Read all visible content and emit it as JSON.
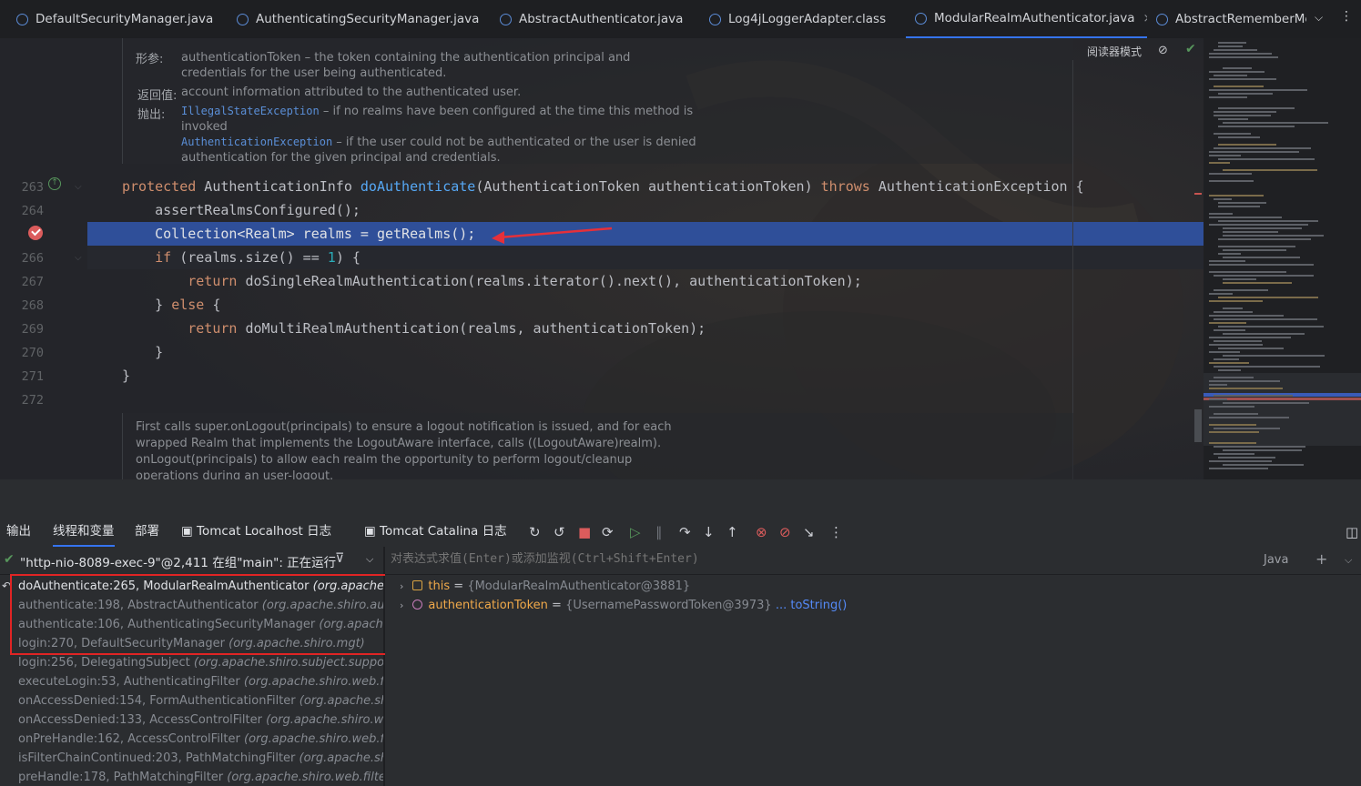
{
  "tabs": [
    {
      "label": "DefaultSecurityManager.java",
      "active": false
    },
    {
      "label": "AuthenticatingSecurityManager.java",
      "active": false
    },
    {
      "label": "AbstractAuthenticator.java",
      "active": false
    },
    {
      "label": "Log4jLoggerAdapter.class",
      "active": false
    },
    {
      "label": "ModularRealmAuthenticator.java",
      "active": true
    },
    {
      "label": "AbstractRememberMe",
      "active": false
    }
  ],
  "editor": {
    "reader_mode_label": "阅读器模式",
    "doc_top": {
      "params_label": "形参:",
      "params_text": "authenticationToken – the token containing the authentication principal and",
      "params_text2": "credentials for the user being authenticated.",
      "return_label": "返回值:",
      "return_text": "account information attributed to the authenticated user.",
      "throws_label": "抛出:",
      "throws_1_name": "IllegalStateException",
      "throws_1_text": " – if no realms have been configured at the time this method is",
      "throws_1_text2": "invoked",
      "throws_2_name": "AuthenticationException",
      "throws_2_text": " – if the user could not be authenticated or the user is denied",
      "throws_2_text2": "authentication for the given principal and credentials."
    },
    "line_numbers": [
      "263",
      "264",
      "265",
      "266",
      "267",
      "268",
      "269",
      "270",
      "271",
      "272"
    ],
    "code_lines": {
      "l263_kw": "protected",
      "l263_type": " AuthenticationInfo ",
      "l263_fn": "doAuthenticate",
      "l263_params": "(AuthenticationToken authenticationToken) ",
      "l263_throws": "throws",
      "l263_exc": " AuthenticationException {",
      "l264": "    assertRealmsConfigured();",
      "l265": "    Collection<Realm> realms = getRealms();",
      "l266_kw": "    if",
      "l266_a": " (realms.size() == ",
      "l266_num": "1",
      "l266_b": ") {",
      "l267_kw": "        return",
      "l267_rest": " doSingleRealmAuthentication(realms.iterator().next(), authenticationToken);",
      "l268_a": "    } ",
      "l268_kw": "else",
      "l268_b": " {",
      "l269_kw": "        return",
      "l269_rest": " doMultiRealmAuthentication(realms, authenticationToken);",
      "l270": "    }",
      "l271": "}"
    },
    "doc_bottom": {
      "line1": "First calls super.onLogout(principals) to ensure a logout notification is issued, and for each",
      "line2": "wrapped Realm that implements the LogoutAware interface, calls ((LogoutAware)realm).",
      "line3": "onLogout(principals) to allow each realm the opportunity to perform logout/cleanup",
      "line4": "operations during an user-logout."
    }
  },
  "debug_tabs": [
    {
      "label": "输出"
    },
    {
      "label": "线程和变量",
      "active": true
    },
    {
      "label": "部署"
    },
    {
      "label": "Tomcat Localhost 日志"
    },
    {
      "label": "Tomcat Catalina 日志"
    }
  ],
  "thread": {
    "label": "\"http-nio-8089-exec-9\"@2,411 在组\"main\": 正在运行"
  },
  "frames": [
    {
      "method": "doAuthenticate:265, ModularRealmAuthenticator",
      "pkg": "(org.apache.shiro.authc.pam)"
    },
    {
      "method": "authenticate:198, AbstractAuthenticator",
      "pkg": "(org.apache.shiro.authc)"
    },
    {
      "method": "authenticate:106, AuthenticatingSecurityManager",
      "pkg": "(org.apache.shiro.mgt)"
    },
    {
      "method": "login:270, DefaultSecurityManager",
      "pkg": "(org.apache.shiro.mgt)"
    },
    {
      "method": "login:256, DelegatingSubject",
      "pkg": "(org.apache.shiro.subject.support)"
    },
    {
      "method": "executeLogin:53, AuthenticatingFilter",
      "pkg": "(org.apache.shiro.web.filter.authc)"
    },
    {
      "method": "onAccessDenied:154, FormAuthenticationFilter",
      "pkg": "(org.apache.shiro.web.filter.authc)"
    },
    {
      "method": "onAccessDenied:133, AccessControlFilter",
      "pkg": "(org.apache.shiro.web.filter)"
    },
    {
      "method": "onPreHandle:162, AccessControlFilter",
      "pkg": "(org.apache.shiro.web.filter)"
    },
    {
      "method": "isFilterChainContinued:203, PathMatchingFilter",
      "pkg": "(org.apache.shiro.web.filter)"
    },
    {
      "method": "preHandle:178, PathMatchingFilter",
      "pkg": "(org.apache.shiro.web.filter)"
    }
  ],
  "eval": {
    "placeholder": "对表达式求值(Enter)或添加监视(Ctrl+Shift+Enter)",
    "lang": "Java"
  },
  "variables": [
    {
      "name": "this",
      "value": "{ModularRealmAuthenticator@3881}",
      "link": ""
    },
    {
      "name": "authenticationToken",
      "value": "{UsernamePasswordToken@3973}",
      "link": "... toString()"
    }
  ]
}
